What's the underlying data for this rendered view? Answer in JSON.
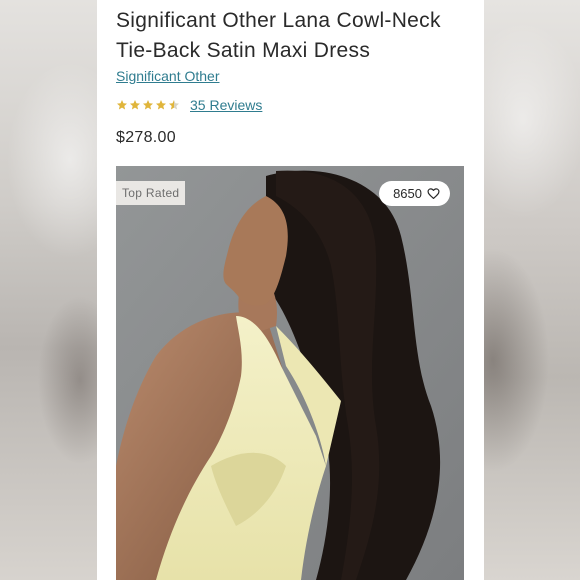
{
  "product": {
    "title": "Significant Other Lana Cowl-Neck Tie-Back Satin Maxi Dress",
    "brand": "Significant Other",
    "rating": 4.5,
    "rating_max": 5,
    "reviews_label": "35 Reviews",
    "price": "$278.00"
  },
  "image": {
    "badge": "Top Rated",
    "likes_count": "8650"
  },
  "colors": {
    "link": "#2f7c8f",
    "star": "#e0b53b",
    "text": "#2a2a2a"
  },
  "icons": {
    "star": "star-icon",
    "heart": "heart-icon"
  }
}
